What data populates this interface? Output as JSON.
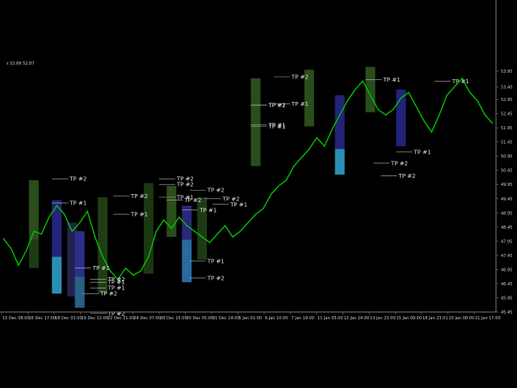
{
  "header": {
    "quote": "s 52.66 52.87"
  },
  "chart_data": {
    "type": "line",
    "x_labels": [
      "15 Dec 08:00",
      "16 Dec 17:00",
      "18 Dec 03:00",
      "19 Dec 12:00",
      "22 Dec 21:00",
      "24 Dec 07:00",
      "28 Dec 15:00",
      "30 Dec 05:00",
      "31 Dec 14:00",
      "5 Jan 01:00",
      "6 Jan 10:00",
      "7 Jan 19:00",
      "11 Jan 05:00",
      "12 Jan 14:00",
      "13 Jan 23:00",
      "15 Jan 09:00",
      "18 Jan 23:01",
      "20 Jan 08:00",
      "21 Jan 17:00"
    ],
    "y_ticks": [
      "53.95",
      "53.40",
      "52.95",
      "52.45",
      "51.95",
      "51.45",
      "50.95",
      "50.45",
      "49.95",
      "49.45",
      "48.95",
      "48.45",
      "47.95",
      "47.45",
      "46.95",
      "46.45",
      "45.95",
      "45.45"
    ],
    "ylim": [
      45.45,
      53.95
    ],
    "price_series": [
      48.05,
      47.7,
      47.1,
      47.6,
      48.3,
      48.2,
      48.8,
      49.2,
      48.9,
      48.3,
      48.6,
      49.0,
      48.1,
      47.4,
      46.9,
      46.6,
      47.0,
      46.75,
      46.9,
      47.4,
      48.3,
      48.7,
      48.4,
      48.8,
      48.5,
      48.3,
      48.1,
      47.9,
      48.2,
      48.5,
      48.1,
      48.3,
      48.6,
      48.9,
      49.1,
      49.6,
      49.9,
      50.1,
      50.6,
      50.9,
      51.2,
      51.6,
      51.3,
      51.9,
      52.4,
      52.9,
      53.3,
      53.6,
      53.1,
      52.6,
      52.4,
      52.6,
      53.0,
      53.2,
      52.7,
      52.2,
      51.8,
      52.4,
      53.1,
      53.4,
      53.7,
      53.2,
      52.9,
      52.4,
      52.1
    ],
    "tp_labels": [
      {
        "text": "TP #2",
        "price": 50.15,
        "index": 7
      },
      {
        "text": "TP #1",
        "price": 49.3,
        "index": 7
      },
      {
        "text": "TP #1",
        "price": 47.0,
        "index": 10
      },
      {
        "text": "TP #2",
        "price": 46.6,
        "index": 12
      },
      {
        "text": "TP #1",
        "price": 46.5,
        "index": 12
      },
      {
        "text": "TP #1",
        "price": 46.3,
        "index": 12
      },
      {
        "text": "TP #2",
        "price": 46.1,
        "index": 11
      },
      {
        "text": "TP #2",
        "price": 45.4,
        "index": 12
      },
      {
        "text": "TP #2",
        "price": 49.55,
        "index": 15
      },
      {
        "text": "TP #1",
        "price": 48.9,
        "index": 15
      },
      {
        "text": "TP #2",
        "price": 50.15,
        "index": 21
      },
      {
        "text": "TP #2",
        "price": 49.95,
        "index": 21
      },
      {
        "text": "TP #1",
        "price": 49.5,
        "index": 21
      },
      {
        "text": "TP #2",
        "price": 49.4,
        "index": 22
      },
      {
        "text": "TP #1",
        "price": 49.05,
        "index": 24
      },
      {
        "text": "TP #2",
        "price": 49.75,
        "index": 25
      },
      {
        "text": "TP #2",
        "price": 49.45,
        "index": 27
      },
      {
        "text": "TP #1",
        "price": 49.25,
        "index": 28
      },
      {
        "text": "TP #1",
        "price": 47.25,
        "index": 25
      },
      {
        "text": "TP #2",
        "price": 46.65,
        "index": 25
      },
      {
        "text": "TP #2",
        "price": 53.75,
        "index": 36
      },
      {
        "text": "TP #1",
        "price": 52.75,
        "index": 33
      },
      {
        "text": "TP #2",
        "price": 52.75,
        "index": 33
      },
      {
        "text": "TP #1",
        "price": 52.0,
        "index": 33
      },
      {
        "text": "TP #1",
        "price": 52.05,
        "index": 33
      },
      {
        "text": "TP #1",
        "price": 52.8,
        "index": 36
      },
      {
        "text": "TP #1",
        "price": 53.65,
        "index": 48
      },
      {
        "text": "TP #1",
        "price": 51.1,
        "index": 52
      },
      {
        "text": "TP #2",
        "price": 50.7,
        "index": 49
      },
      {
        "text": "TP #2",
        "price": 50.25,
        "index": 50
      },
      {
        "text": "TP #1",
        "price": 53.6,
        "index": 57
      }
    ],
    "zones": [
      {
        "index": 4,
        "top": 50.1,
        "bottom": 48.0,
        "color": "#2a4d1c"
      },
      {
        "index": 4,
        "top": 48.0,
        "bottom": 47.0,
        "color": "#1d3a15"
      },
      {
        "index": 7,
        "top": 49.4,
        "bottom": 47.4,
        "color": "#23237a"
      },
      {
        "index": 7,
        "top": 47.4,
        "bottom": 46.1,
        "color": "#2a8fb5"
      },
      {
        "index": 9,
        "top": 48.6,
        "bottom": 46.0,
        "color": "#22224f"
      },
      {
        "index": 10,
        "top": 48.3,
        "bottom": 46.7,
        "color": "#2b2f8a"
      },
      {
        "index": 10,
        "top": 46.7,
        "bottom": 45.6,
        "color": "#2a5f86"
      },
      {
        "index": 13,
        "top": 49.5,
        "bottom": 46.1,
        "color": "#1f3e14"
      },
      {
        "index": 19,
        "top": 50.0,
        "bottom": 46.8,
        "color": "#1b3812"
      },
      {
        "index": 22,
        "top": 49.9,
        "bottom": 48.1,
        "color": "#2a4d1c"
      },
      {
        "index": 24,
        "top": 49.2,
        "bottom": 48.0,
        "color": "#28287c"
      },
      {
        "index": 24,
        "top": 48.0,
        "bottom": 46.5,
        "color": "#2a6aa0"
      },
      {
        "index": 26,
        "top": 49.5,
        "bottom": 47.3,
        "color": "#1d3a15"
      },
      {
        "index": 33,
        "top": 53.7,
        "bottom": 50.6,
        "color": "#2a4d1c"
      },
      {
        "index": 40,
        "top": 54.0,
        "bottom": 52.0,
        "color": "#2a4d1c"
      },
      {
        "index": 44,
        "top": 53.1,
        "bottom": 51.2,
        "color": "#23237a"
      },
      {
        "index": 44,
        "top": 51.2,
        "bottom": 50.3,
        "color": "#2a8fb5"
      },
      {
        "index": 48,
        "top": 54.1,
        "bottom": 52.5,
        "color": "#2a4d1c"
      },
      {
        "index": 52,
        "top": 53.3,
        "bottom": 51.3,
        "color": "#23237a"
      }
    ]
  }
}
